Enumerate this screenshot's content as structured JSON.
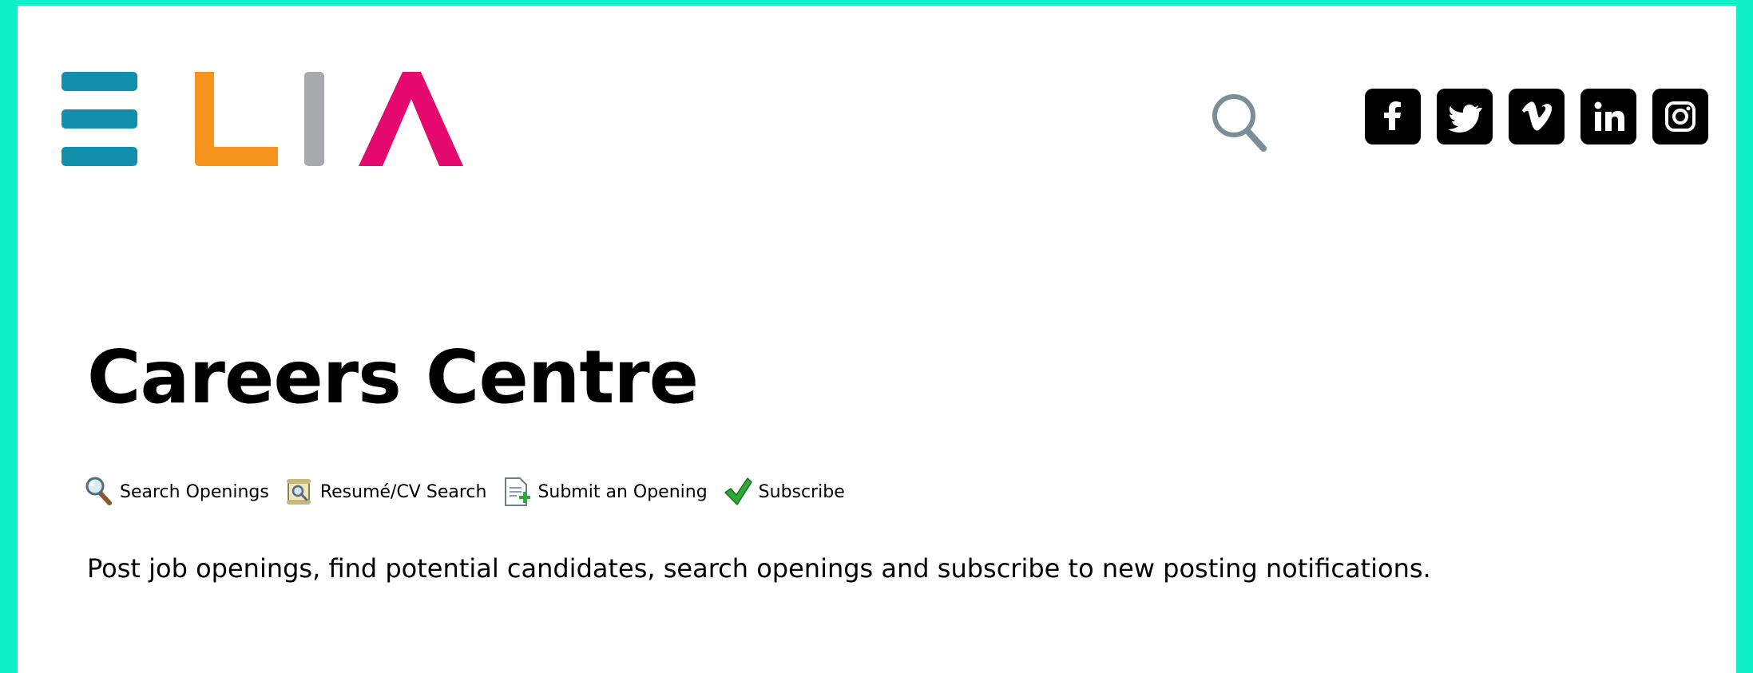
{
  "brand": {
    "name": "ELIA",
    "colors": [
      "#138fae",
      "#f7941d",
      "#a7a9ac",
      "#e4086f"
    ]
  },
  "header": {
    "search_icon": "search-icon",
    "social": [
      {
        "name": "facebook",
        "icon": "facebook-icon"
      },
      {
        "name": "twitter",
        "icon": "twitter-icon"
      },
      {
        "name": "vimeo",
        "icon": "vimeo-icon"
      },
      {
        "name": "linkedin",
        "icon": "linkedin-icon"
      },
      {
        "name": "instagram",
        "icon": "instagram-icon"
      }
    ]
  },
  "page": {
    "title": "Careers Centre",
    "nav": [
      {
        "label": "Search Openings",
        "icon": "magnifier-icon"
      },
      {
        "label": "Resumé/CV Search",
        "icon": "scroll-search-icon"
      },
      {
        "label": "Submit an Opening",
        "icon": "document-add-icon"
      },
      {
        "label": "Subscribe",
        "icon": "checkmark-icon"
      }
    ],
    "intro": "Post job openings, find potential candidates, search openings and subscribe to new posting notifications."
  }
}
